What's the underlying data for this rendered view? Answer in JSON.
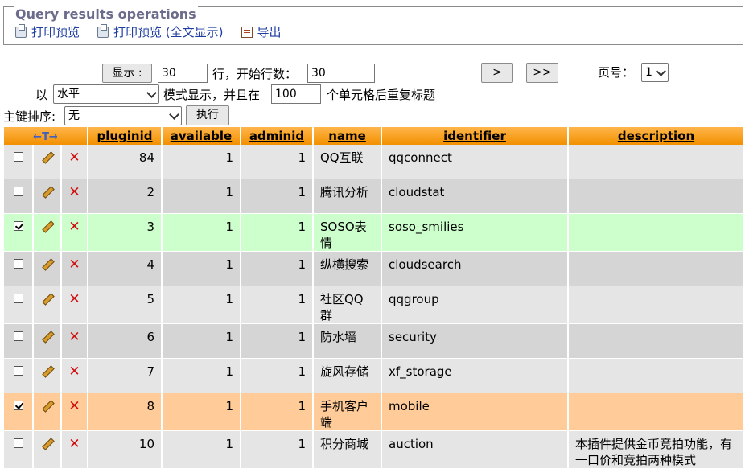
{
  "operations": {
    "legend": "Query results operations",
    "links": [
      "打印预览",
      "打印预览 (全文显示)",
      "导出"
    ]
  },
  "nav": {
    "show_button": "显示 :",
    "rows_value": "30",
    "rows_label": "行，开始行数：",
    "start_value": "30",
    "next_button": ">",
    "last_button": ">>",
    "page_label": "页号：",
    "page_value": "1",
    "mode_prefix": "以",
    "mode_value": "水平",
    "mode_label": "模式显示，并且在",
    "repeat_value": "100",
    "repeat_label": "个单元格后重复标题",
    "sort_label": "主键排序:",
    "sort_value": "无",
    "exec_button": "执行"
  },
  "table": {
    "corner_header": "←T→",
    "columns": [
      "pluginid",
      "available",
      "adminid",
      "name",
      "identifier",
      "description"
    ],
    "rows": [
      {
        "checked": false,
        "marker": "none",
        "pluginid": "84",
        "available": "1",
        "adminid": "1",
        "name": "QQ互联",
        "identifier": "qqconnect",
        "description": ""
      },
      {
        "checked": false,
        "marker": "none",
        "pluginid": "2",
        "available": "1",
        "adminid": "1",
        "name": "腾讯分析",
        "identifier": "cloudstat",
        "description": ""
      },
      {
        "checked": true,
        "marker": "green",
        "pluginid": "3",
        "available": "1",
        "adminid": "1",
        "name": "SOSO表情",
        "identifier": "soso_smilies",
        "description": ""
      },
      {
        "checked": false,
        "marker": "none",
        "pluginid": "4",
        "available": "1",
        "adminid": "1",
        "name": "纵横搜索",
        "identifier": "cloudsearch",
        "description": ""
      },
      {
        "checked": false,
        "marker": "none",
        "pluginid": "5",
        "available": "1",
        "adminid": "1",
        "name": "社区QQ群",
        "identifier": "qqgroup",
        "description": ""
      },
      {
        "checked": false,
        "marker": "none",
        "pluginid": "6",
        "available": "1",
        "adminid": "1",
        "name": "防水墙",
        "identifier": "security",
        "description": ""
      },
      {
        "checked": false,
        "marker": "none",
        "pluginid": "7",
        "available": "1",
        "adminid": "1",
        "name": "旋风存储",
        "identifier": "xf_storage",
        "description": ""
      },
      {
        "checked": true,
        "marker": "orange",
        "pluginid": "8",
        "available": "1",
        "adminid": "1",
        "name": "手机客户端",
        "identifier": "mobile",
        "description": ""
      },
      {
        "checked": false,
        "marker": "none",
        "pluginid": "10",
        "available": "1",
        "adminid": "1",
        "name": "积分商城",
        "identifier": "auction",
        "description": "本插件提供金币竞拍功能，有一口价和竞拍两种模式"
      }
    ]
  },
  "colors": {
    "header": "#f29000",
    "row_odd": "#e5e5e5",
    "row_even": "#d5d5d5",
    "marked_green": "#ccffcc",
    "marked_orange": "#ffcc99",
    "link": "#1f3ea1"
  }
}
